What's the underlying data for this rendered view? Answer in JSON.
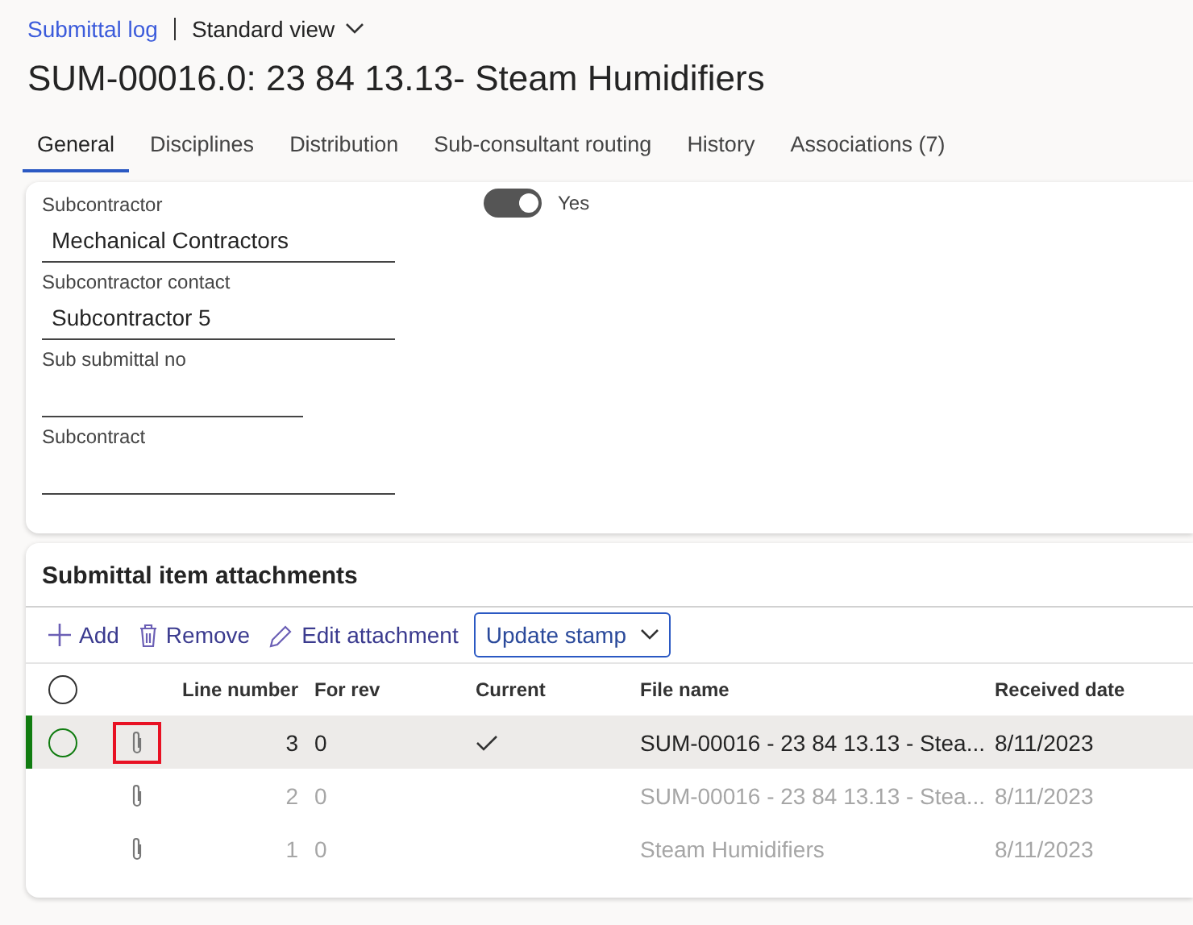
{
  "breadcrumb": {
    "link": "Submittal log",
    "view": "Standard view"
  },
  "title": "SUM-00016.0: 23 84 13.13- Steam Humidifiers",
  "tabs": [
    {
      "label": "General",
      "selected": true
    },
    {
      "label": "Disciplines",
      "selected": false
    },
    {
      "label": "Distribution",
      "selected": false
    },
    {
      "label": "Sub-consultant routing",
      "selected": false
    },
    {
      "label": "History",
      "selected": false
    },
    {
      "label": "Associations (7)",
      "selected": false
    }
  ],
  "general": {
    "fields": [
      {
        "label": "Subcontractor",
        "value": "Mechanical Contractors",
        "wide": true
      },
      {
        "label": "Subcontractor contact",
        "value": "Subcontractor 5",
        "wide": true
      },
      {
        "label": "Sub submittal no",
        "wide": false
      },
      {
        "label": "Subcontract",
        "wide": true
      }
    ],
    "toggle": {
      "on": true,
      "label": "Yes"
    }
  },
  "attachments": {
    "title": "Submittal item attachments",
    "toolbar": [
      {
        "kind": "add",
        "label": "Add"
      },
      {
        "kind": "remove",
        "label": "Remove"
      },
      {
        "kind": "edit",
        "label": "Edit attachment"
      },
      {
        "kind": "dropdown",
        "label": "Update stamp"
      }
    ],
    "select_all": {
      "checked": false
    },
    "columns": [
      "Line number",
      "For rev",
      "Current",
      "File name",
      "Received date"
    ],
    "rows": [
      {
        "selected": true,
        "icon_highlighted": true,
        "greyed": false,
        "line": "3",
        "rev": "0",
        "current": true,
        "file": "SUM-00016 - 23 84 13.13 - Stea...",
        "date": "8/11/2023"
      },
      {
        "selected": false,
        "icon_highlighted": false,
        "greyed": true,
        "line": "2",
        "rev": "0",
        "current": false,
        "file": "SUM-00016 - 23 84 13.13 - Stea...",
        "date": "8/11/2023"
      },
      {
        "selected": false,
        "icon_highlighted": false,
        "greyed": true,
        "line": "1",
        "rev": "0",
        "current": false,
        "file": "Steam Humidifiers",
        "date": "8/11/2023"
      }
    ]
  }
}
